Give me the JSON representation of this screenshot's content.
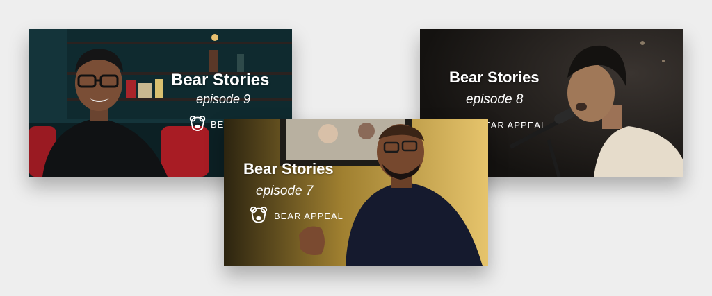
{
  "colors": {
    "page_background": "#eeeeee",
    "text": "#ffffff",
    "card9_bg": "#16363c",
    "card8_bg": "#161412",
    "card7_bg": "#c8a03c"
  },
  "cards": [
    {
      "title": "Bear Stories",
      "episode": "episode 9",
      "brand": "BEAR APPEAL",
      "brand_visible": "BEAR"
    },
    {
      "title": "Bear Stories",
      "episode": "episode 8",
      "brand": "BEAR APPEAL",
      "brand_visible": "EAR APPEAL"
    },
    {
      "title": "Bear Stories",
      "episode": "episode 7",
      "brand": "BEAR APPEAL",
      "brand_visible": "BEAR APPEAL"
    }
  ],
  "icons": {
    "logo": "bear-head-icon"
  }
}
